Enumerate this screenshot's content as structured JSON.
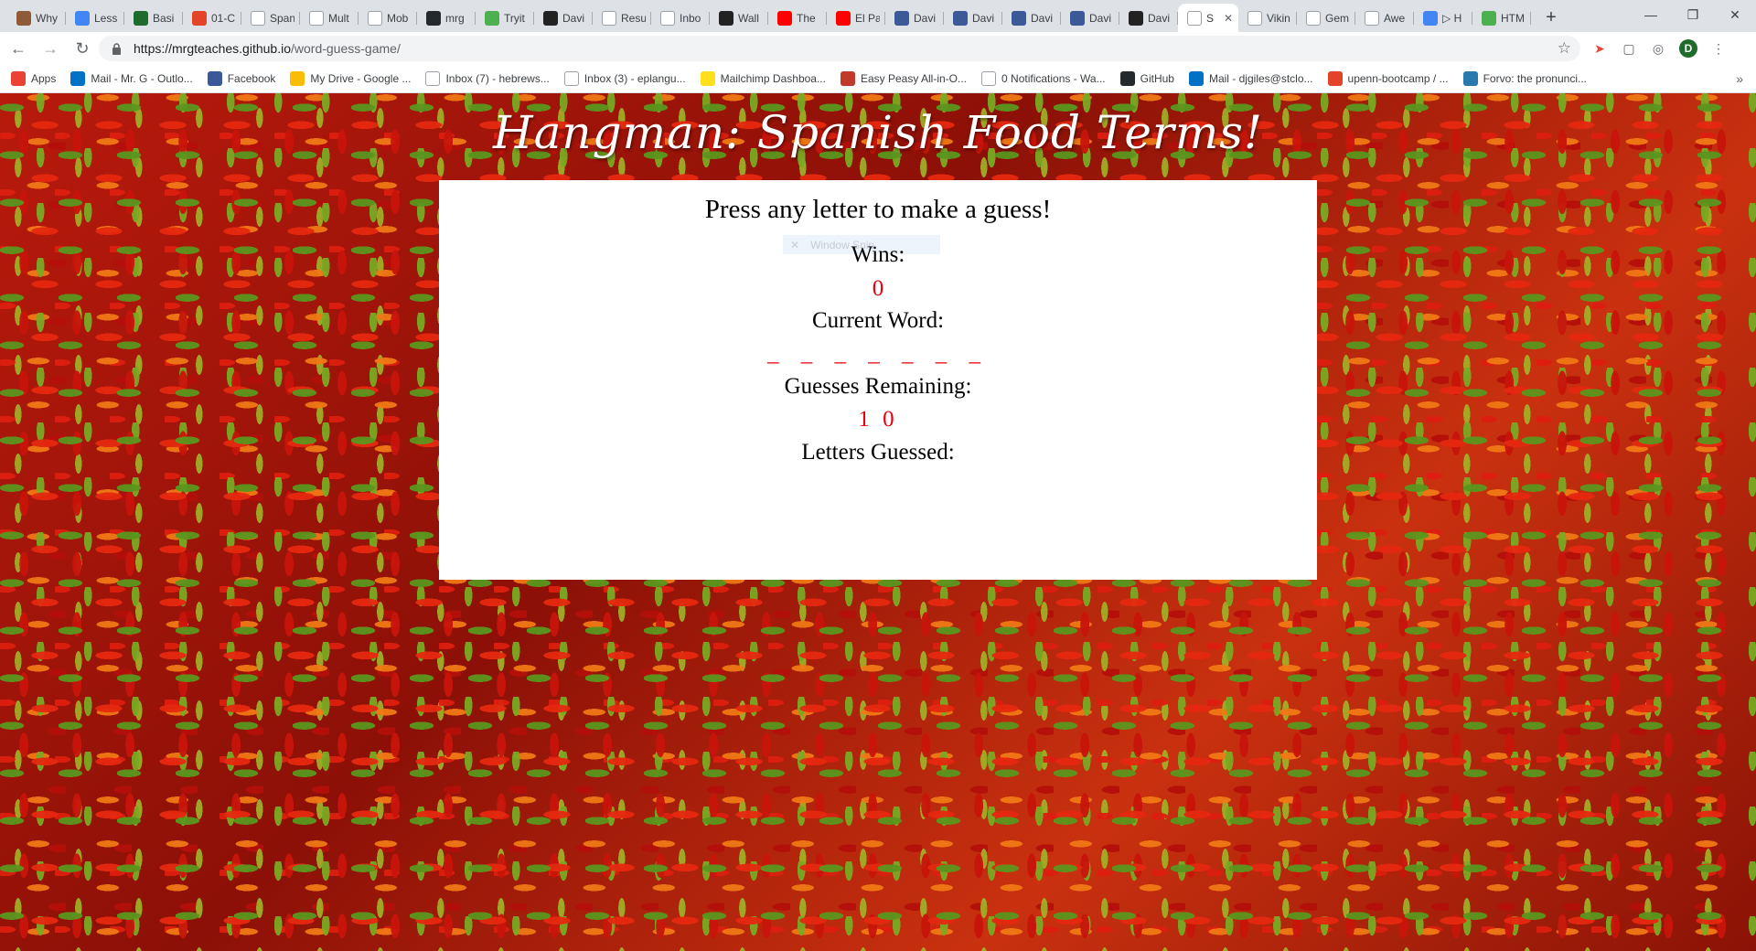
{
  "browser": {
    "tabs": [
      {
        "title": "Why",
        "icon": "person-avatar-icon",
        "color": "#8d5a3a"
      },
      {
        "title": "Less",
        "icon": "chrome-icon",
        "color": "#4285f4"
      },
      {
        "title": "Basi",
        "icon": "green-square-icon",
        "color": "#1e6b2b"
      },
      {
        "title": "01-C",
        "icon": "gitlab-icon",
        "color": "#e24329"
      },
      {
        "title": "Span",
        "icon": "page-icon",
        "color": "#ffffff"
      },
      {
        "title": "Mult",
        "icon": "swirl-icon",
        "color": "#ffffff"
      },
      {
        "title": "Mob",
        "icon": "page-icon",
        "color": "#ffffff"
      },
      {
        "title": "mrg",
        "icon": "github-icon",
        "color": "#24292e"
      },
      {
        "title": "Tryit",
        "icon": "w3schools-icon",
        "color": "#4caf50"
      },
      {
        "title": "Davi",
        "icon": "wikipedia-icon",
        "color": "#222222"
      },
      {
        "title": "Resu",
        "icon": "page-icon",
        "color": "#ffffff"
      },
      {
        "title": "Inbo",
        "icon": "gmail-icon",
        "color": "#ffffff"
      },
      {
        "title": "Wall",
        "icon": "dark-logo-icon",
        "color": "#222222"
      },
      {
        "title": "The",
        "icon": "youtube-icon",
        "color": "#ff0000"
      },
      {
        "title": "El Pa",
        "icon": "youtube-icon",
        "color": "#ff0000"
      },
      {
        "title": "Davi",
        "icon": "facebook-icon",
        "color": "#3b5998"
      },
      {
        "title": "Davi",
        "icon": "facebook-icon",
        "color": "#3b5998"
      },
      {
        "title": "Davi",
        "icon": "facebook-icon",
        "color": "#3b5998"
      },
      {
        "title": "Davi",
        "icon": "facebook-icon",
        "color": "#3b5998"
      },
      {
        "title": "Davi",
        "icon": "wikipedia-icon",
        "color": "#222222"
      },
      {
        "title": "S",
        "icon": "page-icon",
        "color": "#ffffff",
        "active": true
      },
      {
        "title": "Vikin",
        "icon": "page-icon",
        "color": "#ffffff"
      },
      {
        "title": "Gem",
        "icon": "page-icon",
        "color": "#ffffff"
      },
      {
        "title": "Awe",
        "icon": "page-icon",
        "color": "#ffffff"
      },
      {
        "title": "▷ H",
        "icon": "cast-icon",
        "color": "#4285f4"
      },
      {
        "title": "HTM",
        "icon": "w3schools-icon",
        "color": "#4caf50"
      }
    ],
    "url_host": "https://mrgteaches.github.io",
    "url_path": "/word-guess-game/",
    "profile_initial": "D",
    "bookmarks": [
      {
        "label": "Apps",
        "icon": "apps-grid-icon",
        "color": "#ea4335"
      },
      {
        "label": "Mail - Mr. G - Outlo...",
        "icon": "outlook-icon",
        "color": "#0072c6"
      },
      {
        "label": "Facebook",
        "icon": "facebook-icon",
        "color": "#3b5998"
      },
      {
        "label": "My Drive - Google ...",
        "icon": "google-drive-icon",
        "color": "#fbbc04"
      },
      {
        "label": "Inbox (7) - hebrews...",
        "icon": "gmail-icon",
        "color": "#ffffff"
      },
      {
        "label": "Inbox (3) - eplangu...",
        "icon": "gmail-icon",
        "color": "#ffffff"
      },
      {
        "label": "Mailchimp Dashboa...",
        "icon": "mailchimp-icon",
        "color": "#ffe01b"
      },
      {
        "label": "Easy Peasy All-in-O...",
        "icon": "school-icon",
        "color": "#c0392b"
      },
      {
        "label": "0 Notifications - Wa...",
        "icon": "page-icon",
        "color": "#ffffff"
      },
      {
        "label": "GitHub",
        "icon": "github-icon",
        "color": "#24292e"
      },
      {
        "label": "Mail - djgiles@stclo...",
        "icon": "outlook-icon",
        "color": "#0072c6"
      },
      {
        "label": "upenn-bootcamp / ...",
        "icon": "gitlab-icon",
        "color": "#e24329"
      },
      {
        "label": "Forvo: the pronunci...",
        "icon": "forvo-icon",
        "color": "#2a7ab0"
      }
    ],
    "bookmarks_more": "»"
  },
  "page": {
    "title": "Hangman: Spanish Food Terms!",
    "prompt": "Press any letter to make a guess!",
    "snip_label": "Window Snip",
    "wins_label": "Wins:",
    "wins_value": "0",
    "current_word_label": "Current Word:",
    "current_word_blanks": "_ _ _ _ _ _ _",
    "guesses_label": "Guesses Remaining:",
    "guesses_value": "1 0",
    "letters_guessed_label": "Letters Guessed:",
    "letters_guessed_value": "",
    "accent_color": "#e8000d"
  }
}
